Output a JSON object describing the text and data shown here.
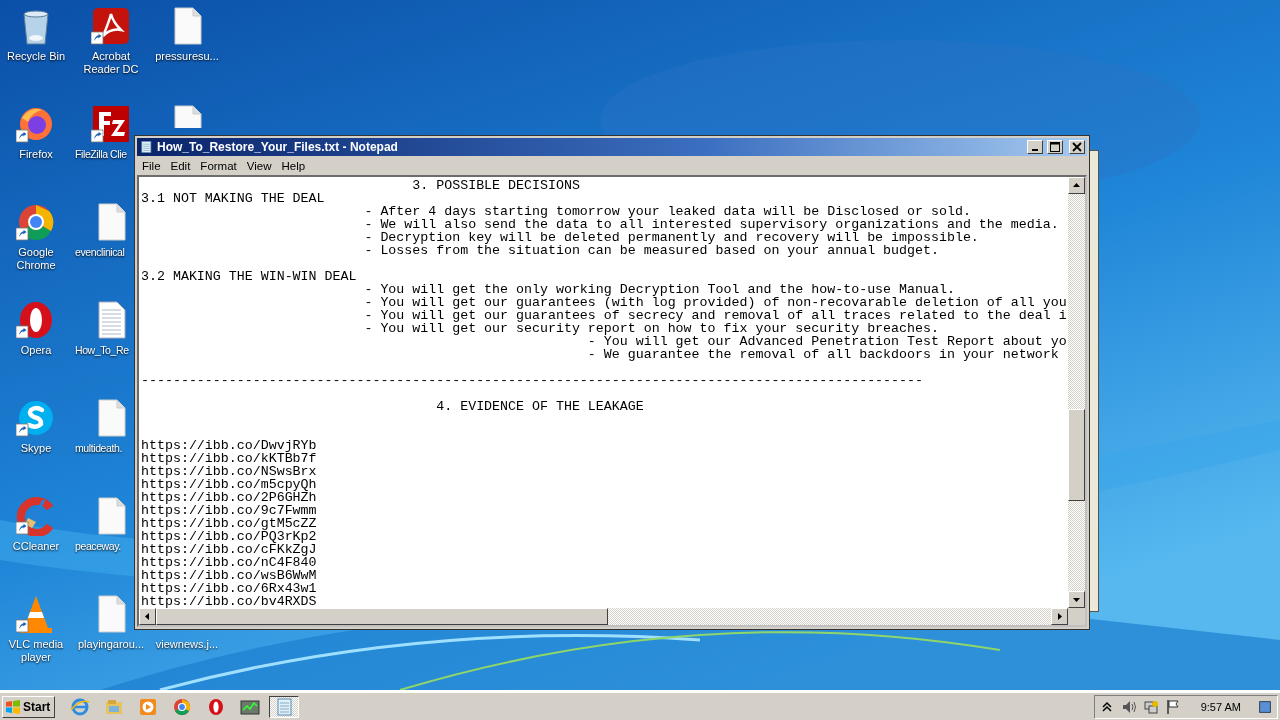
{
  "desktop_icons": [
    {
      "label": "Recycle Bin",
      "kind": "recycle",
      "shortcut": false
    },
    {
      "label": "Firefox",
      "kind": "firefox",
      "shortcut": true
    },
    {
      "label": "Google Chrome",
      "kind": "chrome",
      "shortcut": true
    },
    {
      "label": "Opera",
      "kind": "opera",
      "shortcut": true
    },
    {
      "label": "Skype",
      "kind": "skype",
      "shortcut": true
    },
    {
      "label": "CCleaner",
      "kind": "ccleaner",
      "shortcut": true
    },
    {
      "label": "VLC media player",
      "kind": "vlc",
      "shortcut": true
    },
    {
      "label": "Acrobat Reader DC",
      "kind": "acrobat",
      "shortcut": true
    },
    {
      "label": "FileZilla Clie",
      "kind": "filezilla",
      "shortcut": true
    },
    {
      "label": "evenclinical",
      "kind": "doc",
      "shortcut": false
    },
    {
      "label": "How_To_Re",
      "kind": "textfile",
      "shortcut": false
    },
    {
      "label": "multideath.",
      "kind": "doc",
      "shortcut": false
    },
    {
      "label": "peaceway.",
      "kind": "doc",
      "shortcut": false
    },
    {
      "label": "playingarou...",
      "kind": "doc",
      "shortcut": false
    },
    {
      "label": "pressuresu...",
      "kind": "doc",
      "shortcut": false
    },
    {
      "kind": "doc"
    },
    {
      "label": "viewnews.j..."
    }
  ],
  "window": {
    "title": "How_To_Restore_Your_Files.txt - Notepad",
    "menu": [
      "File",
      "Edit",
      "Format",
      "View",
      "Help"
    ],
    "blocks": [
      {
        "kind": "text",
        "lines": [
          "                                  3. POSSIBLE DECISIONS",
          "3.1 NOT MAKING THE DEAL",
          "                            - After 4 days starting tomorrow your leaked data will be Disclosed or sold.",
          "                            - We will also send the data to all interested supervisory organizations and the media.",
          "                            - Decryption key will be deleted permanently and recovery will be impossible.",
          "                            - Losses from the situation can be measured based on your annual budget."
        ]
      },
      {
        "kind": "text",
        "lines": [
          "3.2 MAKING THE WIN-WIN DEAL",
          "                            - You will get the only working Decryption Tool and the how-to-use Manual.",
          "                            - You will get our guarantees (with log provided) of non-recovarable deletion of all you",
          "                            - You will get our guarantees of secrecy and removal of all traces related to the deal i",
          "                            - You will get our security report on how to fix your security breaches.",
          "                                                        - You will get our Advanced Penetration Test Report about yo",
          "                                                        - We guarantee the removal of all backdoors in your network"
        ]
      },
      {
        "kind": "text",
        "lines": [
          "--------------------------------------------------------------------------------------------------"
        ]
      },
      {
        "kind": "text",
        "lines": [
          "                                     4. EVIDENCE OF THE LEAKAGE"
        ]
      },
      {
        "kind": "links",
        "lines": [
          "https://ibb.co/DwvjRYb",
          "https://ibb.co/kKTBb7f",
          "https://ibb.co/NSwsBrx",
          "https://ibb.co/m5cpyQh",
          "https://ibb.co/2P6GHZh",
          "https://ibb.co/9c7Fwmm",
          "https://ibb.co/gtM5cZZ",
          "https://ibb.co/PQ3rKp2",
          "https://ibb.co/cFKkZgJ",
          "https://ibb.co/nC4F840",
          "https://ibb.co/wsB6WwM",
          "https://ibb.co/6Rx43w1",
          "https://ibb.co/bv4RXDS"
        ]
      }
    ]
  },
  "taskbar": {
    "start": "Start",
    "items": [
      {
        "kind": "ie",
        "selected": false
      },
      {
        "kind": "explorer",
        "selected": false
      },
      {
        "kind": "media",
        "selected": false
      },
      {
        "kind": "chrome",
        "selected": false
      },
      {
        "kind": "opera",
        "selected": false
      },
      {
        "kind": "taskmgr",
        "selected": false
      },
      {
        "kind": "notepad",
        "selected": true
      }
    ],
    "clock": "9:57 AM"
  }
}
